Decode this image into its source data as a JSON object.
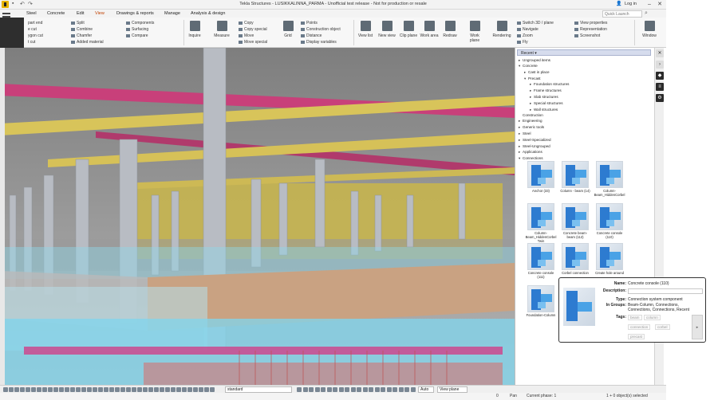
{
  "window": {
    "title": "Tekla Structures - LUSIKKALINNA_PARMA - Unofficial test release - Not for production or resale",
    "login": "Log in"
  },
  "menu": {
    "tabs": [
      "Steel",
      "Concrete",
      "Edit",
      "View",
      "Drawings & reports",
      "Manage",
      "Analysis & design"
    ],
    "active": "View",
    "quick_launch_placeholder": "Quick Launch"
  },
  "ribbon": {
    "col1": [
      "part end",
      "e cut",
      "ygon cut",
      "t cut"
    ],
    "col2": [
      "Split",
      "Combine",
      "Chamfer",
      "Added material"
    ],
    "col3": [
      "Components",
      "Surfacing",
      "Compare"
    ],
    "big1": [
      "Inquire",
      "Measure"
    ],
    "col4": [
      "Copy",
      "Copy special",
      "Move",
      "Move special"
    ],
    "grid": "Grid",
    "col5": [
      "Points",
      "Construction object",
      "Distance",
      "Display variables"
    ],
    "big2": [
      "View list",
      "New view",
      "Clip plane",
      "Work area",
      "Redraw",
      "Work plane",
      "Rendering"
    ],
    "col6": [
      "Switch 3D / plane",
      "Navigate",
      "Zoom",
      "Fly"
    ],
    "col7": [
      "View properties",
      "Representation",
      "Screenshot"
    ],
    "window": "Window"
  },
  "catalog": {
    "dropdown": "Recent",
    "tree": [
      {
        "label": "Ungrouped items",
        "level": 0,
        "expanded": false
      },
      {
        "label": "Concrete",
        "level": 0,
        "expanded": true
      },
      {
        "label": "Cast in place",
        "level": 1,
        "expanded": false
      },
      {
        "label": "Precast",
        "level": 1,
        "expanded": true
      },
      {
        "label": "Foundation structures",
        "level": 2,
        "expanded": false
      },
      {
        "label": "Frame structures",
        "level": 2,
        "expanded": false
      },
      {
        "label": "Slab structures",
        "level": 2,
        "expanded": false
      },
      {
        "label": "Special structures",
        "level": 2,
        "expanded": false
      },
      {
        "label": "Wall structures",
        "level": 2,
        "expanded": false
      },
      {
        "label": "Construction",
        "level": 0,
        "expanded": null
      },
      {
        "label": "Engineering",
        "level": 0,
        "expanded": false
      },
      {
        "label": "Generic tools",
        "level": 0,
        "expanded": false
      },
      {
        "label": "Steel",
        "level": 0,
        "expanded": false
      },
      {
        "label": "Steel-Specialized",
        "level": 0,
        "expanded": false
      },
      {
        "label": "Steel-Ungrouped",
        "level": 0,
        "expanded": false
      },
      {
        "label": "Applications",
        "level": 0,
        "expanded": false
      },
      {
        "label": "Connections",
        "level": 0,
        "expanded": true
      }
    ],
    "thumbnails": [
      {
        "label": "Anchor (33)"
      },
      {
        "label": "Column - beam (14)"
      },
      {
        "label": "Column-Beam_HiddenCorbel"
      },
      {
        "label": "Column-Beam_HiddenCorbel Twin"
      },
      {
        "label": "Concrete beam-beam (112)"
      },
      {
        "label": "Concrete console (110)"
      },
      {
        "label": "Concrete console (111)"
      },
      {
        "label": "Corbel connection"
      },
      {
        "label": "Create hole around"
      },
      {
        "label": "Foundation-Column"
      }
    ]
  },
  "tooltip": {
    "name_key": "Name:",
    "name": "Concrete console (110)",
    "desc_key": "Description:",
    "type_key": "Type:",
    "type": "Connection system component",
    "groups_key": "In Groups:",
    "groups_line1": "Beam-Column, Connections,",
    "groups_line2": "Connections, Connections, Recent",
    "tags_key": "Tags:",
    "tags": [
      "beam",
      "column",
      "connection",
      "corbel",
      "precast"
    ]
  },
  "bottombar": {
    "select_standard": "standard",
    "select_auto": "Auto",
    "select_view": "View plane"
  },
  "status": {
    "count": "0",
    "mode": "Pan",
    "phase": "Current phase: 1",
    "selected": "1 + 0 object(s) selected"
  },
  "colors": {
    "accent": "#c04000",
    "steel_yellow": "#d8c45a",
    "magenta_beam": "#c8407a",
    "glass_cyan": "#7fd6ee",
    "component_blue": "#2d7bd0"
  }
}
